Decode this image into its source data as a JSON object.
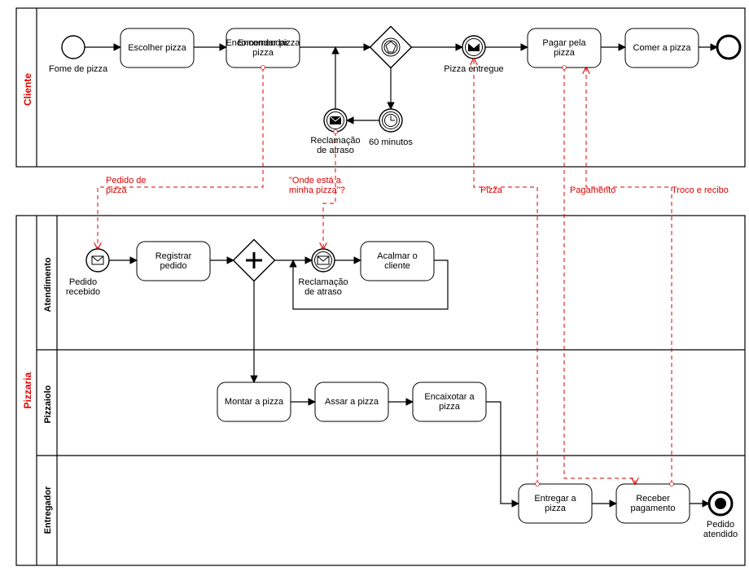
{
  "pools": {
    "cliente": {
      "label": "Cliente"
    },
    "pizzaria": {
      "label": "Pizzaria",
      "lanes": {
        "atendimento": {
          "label": "Atendimento"
        },
        "pizzaiolo": {
          "label": "Pizzaiolo"
        },
        "entregador": {
          "label": "Entregador"
        }
      }
    }
  },
  "tasks": {
    "escolher": "Escolher pizza",
    "encomendar": "Encomendar pizza",
    "pagar": "Pagar pela pizza",
    "comer": "Comer a pizza",
    "registrar": "Registrar pedido",
    "acalmar": "Acalmar o cliente",
    "montar": "Montar a pizza",
    "assar": "Assar a pizza",
    "encaixotar": "Encaixotar a pizza",
    "entregar": "Entregar a pizza",
    "receber": "Receber pagamento"
  },
  "events": {
    "fome": "Fome de pizza",
    "pizza_entregue": "Pizza entregue",
    "minutos60": "60 minutos",
    "reclamacao_c": "Reclamação de atraso",
    "pedido_recebido": "Pedido recebido",
    "reclamacao_a": "Reclamação de atraso",
    "pedido_atendido": "Pedido atendido"
  },
  "messages": {
    "pedido_pizza": "Pedido de pizza",
    "onde_pizza": "\"Onde está a minha pizza\"?",
    "pizza": "Pizza",
    "pagamento": "Pagamento",
    "troco": "Troco e recibo"
  }
}
